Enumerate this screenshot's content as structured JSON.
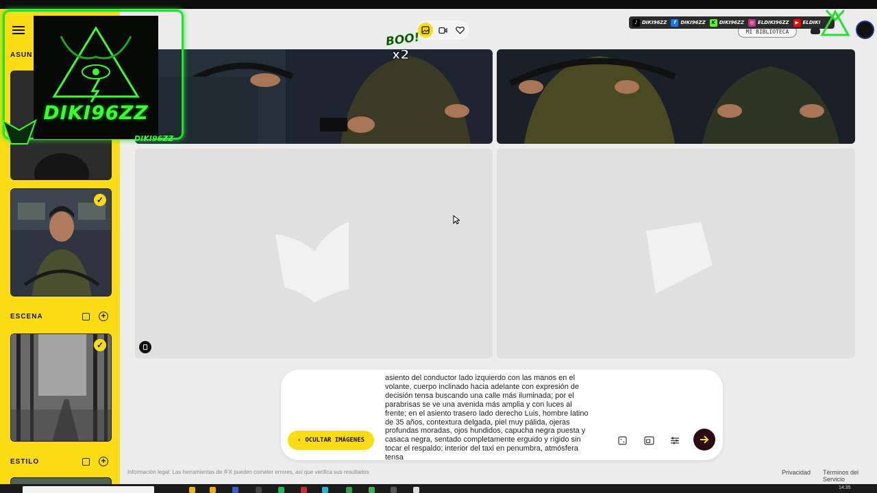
{
  "sidebar": {
    "sections": [
      {
        "label": "ASUN"
      },
      {
        "label": "ESCENA"
      },
      {
        "label": "ESTILO"
      }
    ]
  },
  "overlay": {
    "logo_text": "DIKI96ZZ",
    "tag": "DIKI96ZZ",
    "boo": "BOO!",
    "boo_multiplier": "x2"
  },
  "socials": [
    {
      "name": "tiktok",
      "label": "DIKI96ZZ",
      "color": "#000000"
    },
    {
      "name": "facebook",
      "label": "DIKI96ZZ",
      "color": "#1877f2"
    },
    {
      "name": "kick",
      "label": "DIKI96ZZ",
      "color": "#53fc18"
    },
    {
      "name": "instagram",
      "label": "ELDIKI96ZZ",
      "color": "#c13584"
    },
    {
      "name": "youtube",
      "label": "ELDIKI",
      "color": "#ff0000"
    }
  ],
  "header": {
    "library_label": "MI BIBLIOTECA"
  },
  "prompt": {
    "text": "asiento del conductor lado izquierdo con las manos en el volante, cuerpo inclinado hacia adelante con expresión de decisión tensa buscando una calle más iluminada; por el parabrisas se ve una avenida más amplia y con luces al frente; en el asiento trasero lado derecho Luis, hombre latino de 35 años, contextura delgada, piel muy pálida, ojeras profundas moradas, ojos hundidos, capucha negra puesta y casaca negra, sentado completamente erguido y rígido sin tocar el respaldo; interior del taxi en penumbra, atmósfera tensa",
    "hide_images_label": "OCULTAR IMÁGENES"
  },
  "footer": {
    "legal": "Información legal: Las herramientas de /FX pueden cometer errores, así que verifica sus resultados",
    "privacy": "Privacidad",
    "terms": "Términos del Servicio"
  },
  "taskbar": {
    "clock": "14:35"
  },
  "colors": {
    "accent": "#fbdc14",
    "neon_green": "#39ff2e",
    "send_button": "#2a0c12"
  }
}
